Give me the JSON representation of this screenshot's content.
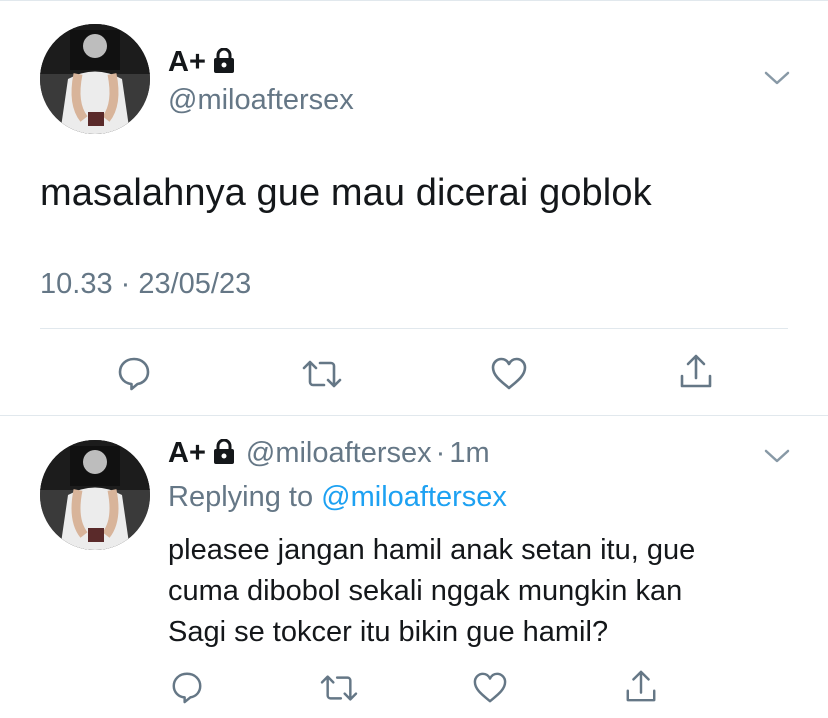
{
  "tweet": {
    "display_name": "A+",
    "handle": "@miloaftersex",
    "text": "masalahnya gue mau dicerai goblok",
    "timestamp": "10.33 · 23/05/23",
    "avatar_icon": "profile-photo",
    "protected_icon": "lock-icon",
    "menu_icon": "chevron-down-icon"
  },
  "reply": {
    "display_name": "A+",
    "handle": "@miloaftersex",
    "separator": "·",
    "time_ago": "1m",
    "replying_prefix": "Replying to ",
    "replying_to": "@miloaftersex",
    "text_lines": [
      "pleasee jangan hamil anak setan itu, gue",
      "cuma dibobol sekali nggak mungkin kan",
      "Sagi se tokcer itu bikin gue hamil?"
    ]
  },
  "actions": [
    "reply-icon",
    "retweet-icon",
    "like-icon",
    "share-icon"
  ],
  "colors": {
    "text": "#14171a",
    "secondary": "#657786",
    "link": "#1da1f2",
    "divider": "#e1e8ed"
  }
}
